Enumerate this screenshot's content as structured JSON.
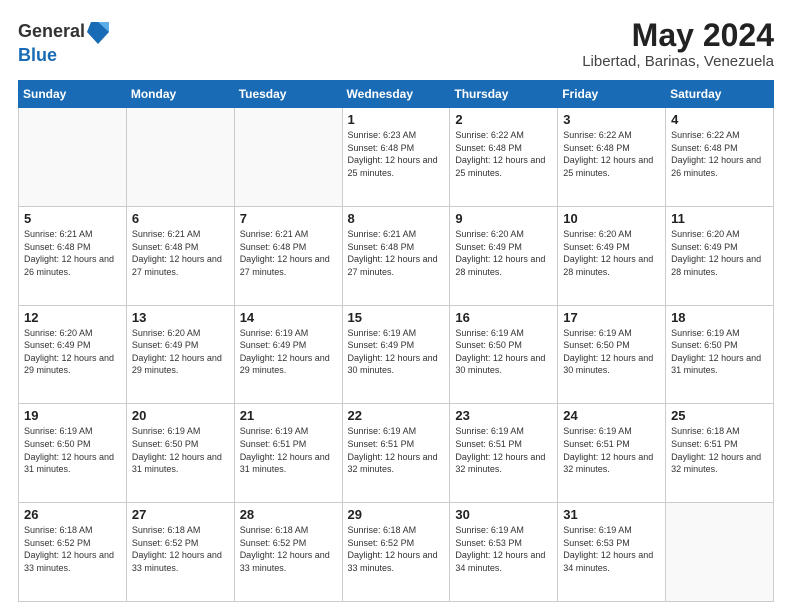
{
  "header": {
    "logo_general": "General",
    "logo_blue": "Blue",
    "month_title": "May 2024",
    "location": "Libertad, Barinas, Venezuela"
  },
  "days_of_week": [
    "Sunday",
    "Monday",
    "Tuesday",
    "Wednesday",
    "Thursday",
    "Friday",
    "Saturday"
  ],
  "weeks": [
    [
      {
        "day": "",
        "info": ""
      },
      {
        "day": "",
        "info": ""
      },
      {
        "day": "",
        "info": ""
      },
      {
        "day": "1",
        "info": "Sunrise: 6:23 AM\nSunset: 6:48 PM\nDaylight: 12 hours and 25 minutes."
      },
      {
        "day": "2",
        "info": "Sunrise: 6:22 AM\nSunset: 6:48 PM\nDaylight: 12 hours and 25 minutes."
      },
      {
        "day": "3",
        "info": "Sunrise: 6:22 AM\nSunset: 6:48 PM\nDaylight: 12 hours and 25 minutes."
      },
      {
        "day": "4",
        "info": "Sunrise: 6:22 AM\nSunset: 6:48 PM\nDaylight: 12 hours and 26 minutes."
      }
    ],
    [
      {
        "day": "5",
        "info": "Sunrise: 6:21 AM\nSunset: 6:48 PM\nDaylight: 12 hours and 26 minutes."
      },
      {
        "day": "6",
        "info": "Sunrise: 6:21 AM\nSunset: 6:48 PM\nDaylight: 12 hours and 27 minutes."
      },
      {
        "day": "7",
        "info": "Sunrise: 6:21 AM\nSunset: 6:48 PM\nDaylight: 12 hours and 27 minutes."
      },
      {
        "day": "8",
        "info": "Sunrise: 6:21 AM\nSunset: 6:48 PM\nDaylight: 12 hours and 27 minutes."
      },
      {
        "day": "9",
        "info": "Sunrise: 6:20 AM\nSunset: 6:49 PM\nDaylight: 12 hours and 28 minutes."
      },
      {
        "day": "10",
        "info": "Sunrise: 6:20 AM\nSunset: 6:49 PM\nDaylight: 12 hours and 28 minutes."
      },
      {
        "day": "11",
        "info": "Sunrise: 6:20 AM\nSunset: 6:49 PM\nDaylight: 12 hours and 28 minutes."
      }
    ],
    [
      {
        "day": "12",
        "info": "Sunrise: 6:20 AM\nSunset: 6:49 PM\nDaylight: 12 hours and 29 minutes."
      },
      {
        "day": "13",
        "info": "Sunrise: 6:20 AM\nSunset: 6:49 PM\nDaylight: 12 hours and 29 minutes."
      },
      {
        "day": "14",
        "info": "Sunrise: 6:19 AM\nSunset: 6:49 PM\nDaylight: 12 hours and 29 minutes."
      },
      {
        "day": "15",
        "info": "Sunrise: 6:19 AM\nSunset: 6:49 PM\nDaylight: 12 hours and 30 minutes."
      },
      {
        "day": "16",
        "info": "Sunrise: 6:19 AM\nSunset: 6:50 PM\nDaylight: 12 hours and 30 minutes."
      },
      {
        "day": "17",
        "info": "Sunrise: 6:19 AM\nSunset: 6:50 PM\nDaylight: 12 hours and 30 minutes."
      },
      {
        "day": "18",
        "info": "Sunrise: 6:19 AM\nSunset: 6:50 PM\nDaylight: 12 hours and 31 minutes."
      }
    ],
    [
      {
        "day": "19",
        "info": "Sunrise: 6:19 AM\nSunset: 6:50 PM\nDaylight: 12 hours and 31 minutes."
      },
      {
        "day": "20",
        "info": "Sunrise: 6:19 AM\nSunset: 6:50 PM\nDaylight: 12 hours and 31 minutes."
      },
      {
        "day": "21",
        "info": "Sunrise: 6:19 AM\nSunset: 6:51 PM\nDaylight: 12 hours and 31 minutes."
      },
      {
        "day": "22",
        "info": "Sunrise: 6:19 AM\nSunset: 6:51 PM\nDaylight: 12 hours and 32 minutes."
      },
      {
        "day": "23",
        "info": "Sunrise: 6:19 AM\nSunset: 6:51 PM\nDaylight: 12 hours and 32 minutes."
      },
      {
        "day": "24",
        "info": "Sunrise: 6:19 AM\nSunset: 6:51 PM\nDaylight: 12 hours and 32 minutes."
      },
      {
        "day": "25",
        "info": "Sunrise: 6:18 AM\nSunset: 6:51 PM\nDaylight: 12 hours and 32 minutes."
      }
    ],
    [
      {
        "day": "26",
        "info": "Sunrise: 6:18 AM\nSunset: 6:52 PM\nDaylight: 12 hours and 33 minutes."
      },
      {
        "day": "27",
        "info": "Sunrise: 6:18 AM\nSunset: 6:52 PM\nDaylight: 12 hours and 33 minutes."
      },
      {
        "day": "28",
        "info": "Sunrise: 6:18 AM\nSunset: 6:52 PM\nDaylight: 12 hours and 33 minutes."
      },
      {
        "day": "29",
        "info": "Sunrise: 6:18 AM\nSunset: 6:52 PM\nDaylight: 12 hours and 33 minutes."
      },
      {
        "day": "30",
        "info": "Sunrise: 6:19 AM\nSunset: 6:53 PM\nDaylight: 12 hours and 34 minutes."
      },
      {
        "day": "31",
        "info": "Sunrise: 6:19 AM\nSunset: 6:53 PM\nDaylight: 12 hours and 34 minutes."
      },
      {
        "day": "",
        "info": ""
      }
    ]
  ]
}
